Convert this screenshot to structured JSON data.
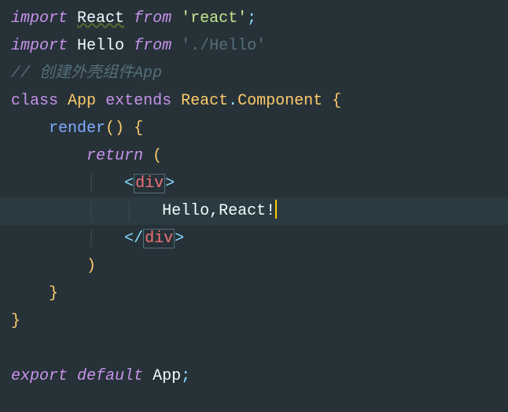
{
  "code": {
    "line1": {
      "import": "import",
      "react": "React",
      "from": "from",
      "q1": "'",
      "str": "react",
      "q2": "'",
      "semi": ";"
    },
    "line2": {
      "import": "import",
      "hello": "Hello",
      "from": "from",
      "q1": "'",
      "str": "./Hello",
      "q2": "'"
    },
    "line3": {
      "comment": "// 创建外壳组件App"
    },
    "line4": {
      "class": "class",
      "app": "App",
      "extends": "extends",
      "react": "React",
      "dot": ".",
      "component": "Component",
      "brace": "{"
    },
    "line5": {
      "render": "render",
      "parens": "()",
      "brace": "{"
    },
    "line6": {
      "return": "return",
      "paren": "("
    },
    "line7": {
      "lt": "<",
      "tag": "div",
      "gt": ">"
    },
    "line8": {
      "text": "Hello,React!"
    },
    "line9": {
      "lt": "</",
      "tag": "div",
      "gt": ">"
    },
    "line10": {
      "paren": ")"
    },
    "line11": {
      "brace": "}"
    },
    "line12": {
      "brace": "}"
    },
    "line14": {
      "export": "export",
      "default": "default",
      "app": "App",
      "semi": ";"
    }
  }
}
